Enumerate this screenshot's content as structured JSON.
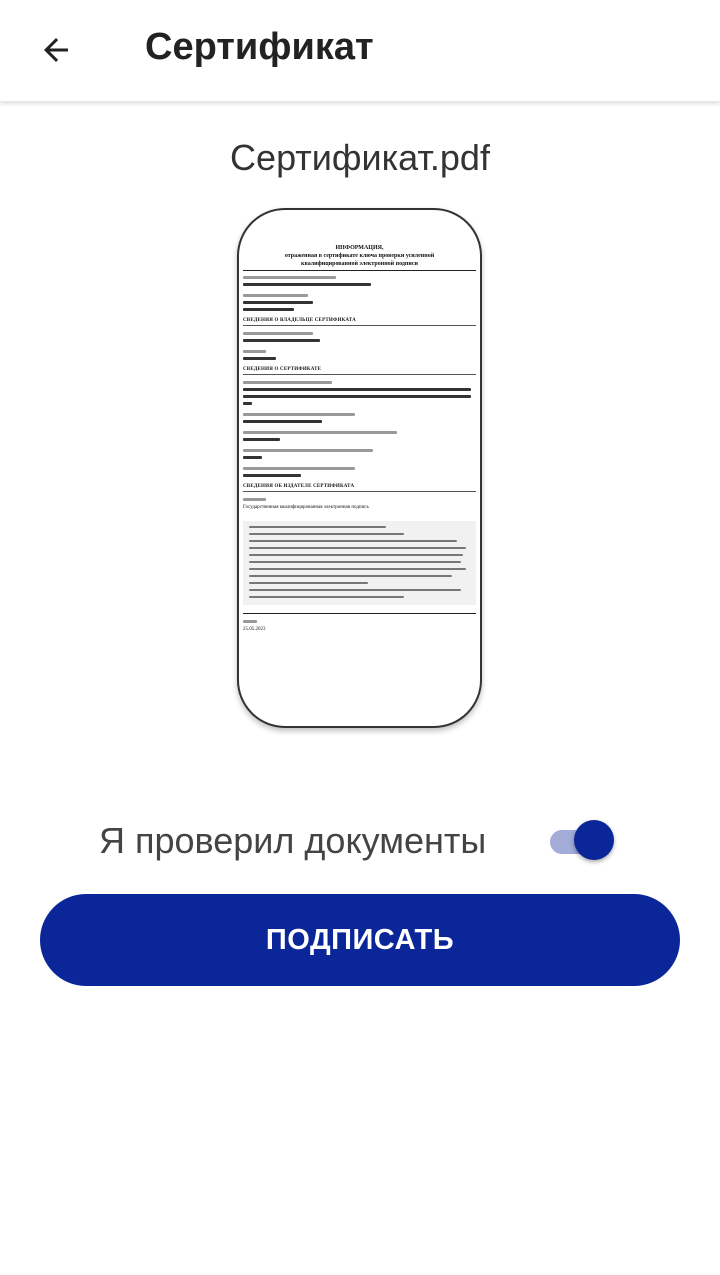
{
  "appbar": {
    "title": "Сертификат",
    "back_icon": "arrow-left-icon"
  },
  "document": {
    "file_name": "Сертификат.pdf",
    "preview": {
      "heading_line1": "ИНФОРМАЦИЯ,",
      "heading_line2": "отраженная в сертификате ключа проверки усиленной",
      "heading_line3": "квалифицированной электронной подписи",
      "section_owner": "СВЕДЕНИЯ О ВЛАДЕЛЬЦЕ СЕРТИФИКАТА",
      "section_cert": "СВЕДЕНИЯ О СЕРТИФИКАТЕ",
      "section_issuer": "СВЕДЕНИЯ ОБ ИЗДАТЕЛЕ СЕРТИФИКАТА",
      "issuer_name": "Государственная квалифицированная электронная подпись",
      "date": "25.05.2023"
    }
  },
  "confirm": {
    "label": "Я проверил документы",
    "toggle_on": true
  },
  "sign_button": {
    "label": "ПОДПИСАТЬ"
  },
  "colors": {
    "primary": "#0b2699",
    "toggle_track": "#a3abd8"
  }
}
